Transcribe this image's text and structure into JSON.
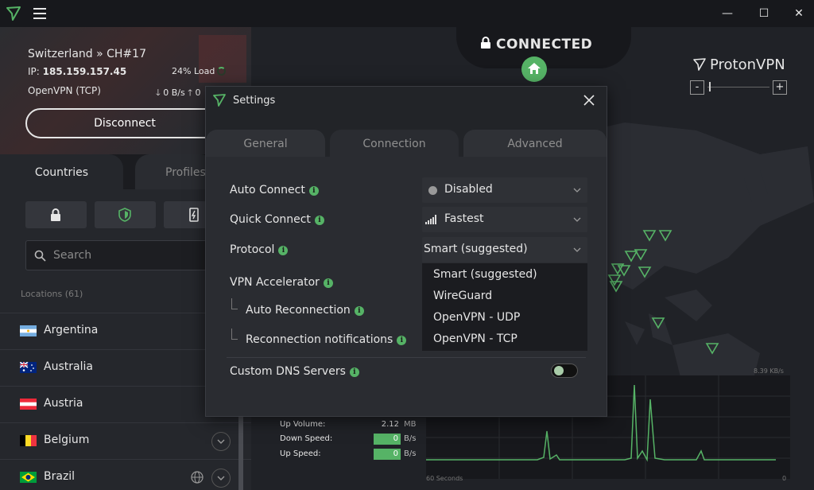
{
  "window": {
    "minimize": "—",
    "maximize": "☐",
    "close": "✕"
  },
  "server": {
    "location": "Switzerland » CH#17",
    "ip_label": "IP:",
    "ip": "185.159.157.45",
    "load": "24% Load",
    "protocol": "OpenVPN (TCP)",
    "down": "0 B/s",
    "up": "0"
  },
  "disconnect_label": "Disconnect",
  "tabs": {
    "countries": "Countries",
    "profiles": "Profiles"
  },
  "search": {
    "placeholder": "Search"
  },
  "locations_header": "Locations (61)",
  "countries": [
    {
      "name": "Argentina",
      "flag": "argentina"
    },
    {
      "name": "Australia",
      "flag": "australia"
    },
    {
      "name": "Austria",
      "flag": "austria"
    },
    {
      "name": "Belgium",
      "flag": "belgium"
    },
    {
      "name": "Brazil",
      "flag": "brazil"
    }
  ],
  "status": {
    "connected": "CONNECTED"
  },
  "brand": "ProtonVPN",
  "zoom": {
    "minus": "-",
    "plus": "+"
  },
  "stats": {
    "up_volume": {
      "label": "Up Volume:",
      "value": "2.12",
      "unit": "MB"
    },
    "down_speed": {
      "label": "Down Speed:",
      "value": "0",
      "unit": "B/s"
    },
    "up_speed": {
      "label": "Up Speed:",
      "value": "0",
      "unit": "B/s"
    }
  },
  "graph": {
    "rate": "8.39 KB/s",
    "time": "60 Seconds",
    "zero": "0"
  },
  "settings": {
    "title": "Settings",
    "tabs": {
      "general": "General",
      "connection": "Connection",
      "advanced": "Advanced"
    },
    "active_tab": "Connection",
    "auto_connect": {
      "label": "Auto Connect",
      "value": "Disabled"
    },
    "quick_connect": {
      "label": "Quick Connect",
      "value": "Fastest"
    },
    "protocol": {
      "label": "Protocol",
      "value": "Smart (suggested)"
    },
    "vpn_accelerator": {
      "label": "VPN Accelerator"
    },
    "auto_reconnection": {
      "label": "Auto Reconnection"
    },
    "reconnection_notifications": {
      "label": "Reconnection notifications"
    },
    "custom_dns": {
      "label": "Custom DNS Servers",
      "enabled": false
    },
    "protocol_options": [
      "Smart (suggested)",
      "WireGuard",
      "OpenVPN - UDP",
      "OpenVPN - TCP"
    ],
    "info_glyph": "i"
  },
  "colors": {
    "accent": "#56b366",
    "bg": "#1c1e23",
    "panel": "#25272c",
    "modal": "#2a2c31"
  }
}
